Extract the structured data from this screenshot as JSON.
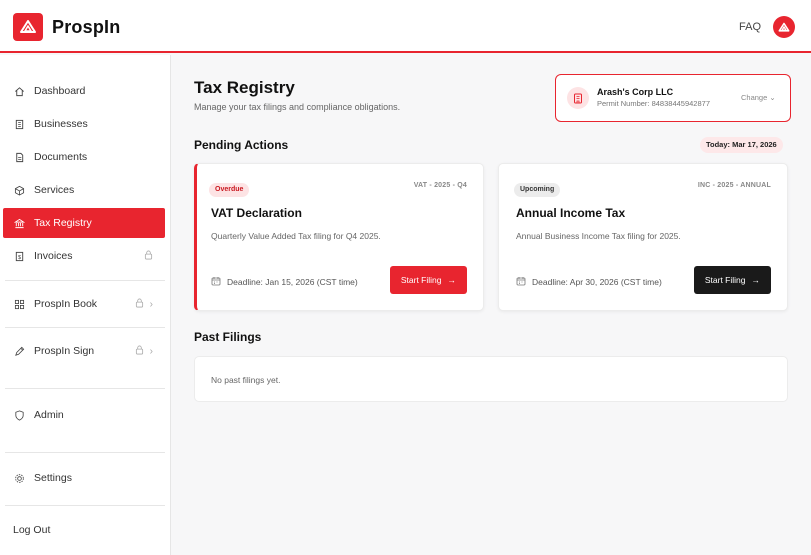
{
  "header": {
    "brand": "ProspIn",
    "faq": "FAQ"
  },
  "sidebar": {
    "items": [
      {
        "label": "Dashboard",
        "icon": "home-icon"
      },
      {
        "label": "Businesses",
        "icon": "building-icon"
      },
      {
        "label": "Documents",
        "icon": "document-icon"
      },
      {
        "label": "Services",
        "icon": "cube-icon"
      },
      {
        "label": "Tax Registry",
        "icon": "bank-icon",
        "active": true
      },
      {
        "label": "Invoices",
        "icon": "invoice-icon",
        "locked": true
      },
      {
        "label": "ProspIn Book",
        "icon": "grid-icon",
        "locked": true
      },
      {
        "label": "ProspIn Sign",
        "icon": "pen-icon",
        "locked": true
      },
      {
        "label": "Admin",
        "icon": "shield-icon"
      },
      {
        "label": "Settings",
        "icon": "gear-icon"
      }
    ],
    "logout": "Log Out"
  },
  "main": {
    "title": "Tax Registry",
    "subtitle": "Manage your tax filings and compliance obligations.",
    "company": {
      "name": "Arash's Corp LLC",
      "permit": "Permit Number: 84838445942877",
      "change": "Change"
    },
    "pending": {
      "title": "Pending Actions",
      "today": "Today: Mar 17, 2026",
      "cards": [
        {
          "status": "Overdue",
          "code": "VAT - 2025 - Q4",
          "title": "VAT Declaration",
          "description": "Quarterly Value Added Tax filing for Q4 2025.",
          "deadline": "Deadline: Jan 15, 2026 (CST time)",
          "action": "Start Filing"
        },
        {
          "status": "Upcoming",
          "code": "INC - 2025 - ANNUAL",
          "title": "Annual Income Tax",
          "description": "Annual Business Income Tax filing for 2025.",
          "deadline": "Deadline: Apr 30, 2026 (CST time)",
          "action": "Start Filing"
        }
      ]
    },
    "past": {
      "title": "Past Filings",
      "empty": "No past filings yet."
    }
  },
  "colors": {
    "accent": "#e8252f",
    "dark_button": "#1a1a1a"
  }
}
